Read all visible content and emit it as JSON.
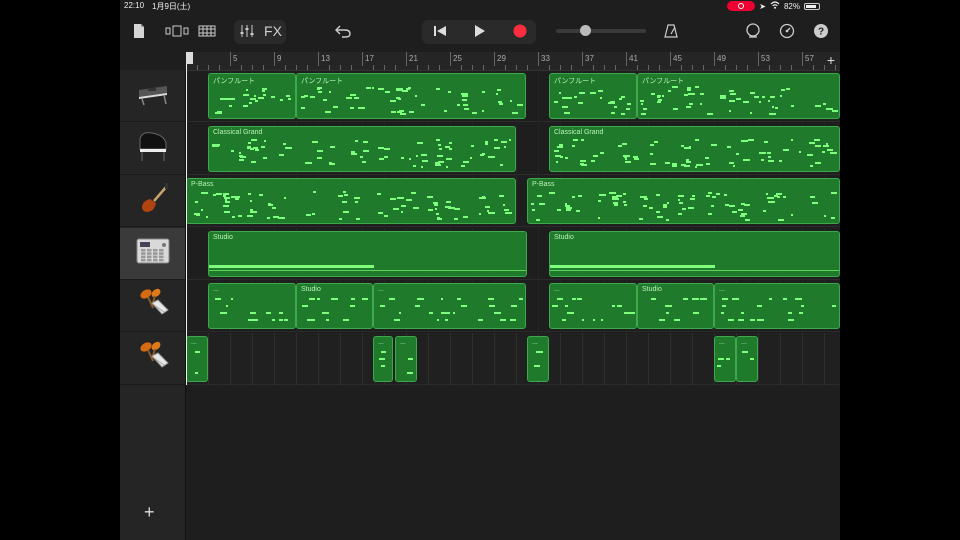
{
  "status": {
    "time": "22:10",
    "date": "1月9日(土)",
    "battery": "82%"
  },
  "toolbar": {
    "fx_label": "FX"
  },
  "ruler": {
    "bars": [
      "1",
      "5",
      "9",
      "13",
      "17",
      "21",
      "25",
      "29",
      "33",
      "37",
      "41",
      "45",
      "49",
      "53",
      "57"
    ]
  },
  "colors": {
    "region_fill": "#1f7a2b",
    "region_border": "#3ea94c",
    "record": "#ff2d3d"
  },
  "tracks": [
    {
      "instrument": "synth-keyboard-icon",
      "regions": [
        {
          "label": "パンフルート"
        },
        {
          "label": "パンフルート"
        },
        {
          "label": "パンフルート"
        },
        {
          "label": "パンフルート"
        }
      ]
    },
    {
      "instrument": "grand-piano-icon",
      "regions": [
        {
          "label": "Classical Grand"
        },
        {
          "label": "Classical Grand"
        }
      ]
    },
    {
      "instrument": "bass-guitar-icon",
      "regions": [
        {
          "label": "P-Bass"
        },
        {
          "label": "P-Bass"
        }
      ]
    },
    {
      "instrument": "drum-machine-icon",
      "regions": [
        {
          "label": "Studio"
        },
        {
          "label": "Studio"
        }
      ]
    },
    {
      "instrument": "percussion-icon",
      "regions": [
        {
          "label": "..."
        },
        {
          "label": "Studio"
        },
        {
          "label": "..."
        },
        {
          "label": "..."
        },
        {
          "label": "Studio"
        },
        {
          "label": "..."
        }
      ]
    },
    {
      "instrument": "percussion-icon",
      "regions": [
        {
          "label": "..."
        },
        {
          "label": "..."
        },
        {
          "label": "..."
        },
        {
          "label": "..."
        },
        {
          "label": "..."
        },
        {
          "label": "..."
        }
      ]
    }
  ],
  "add_track_label": "+",
  "add_section_label": "+"
}
